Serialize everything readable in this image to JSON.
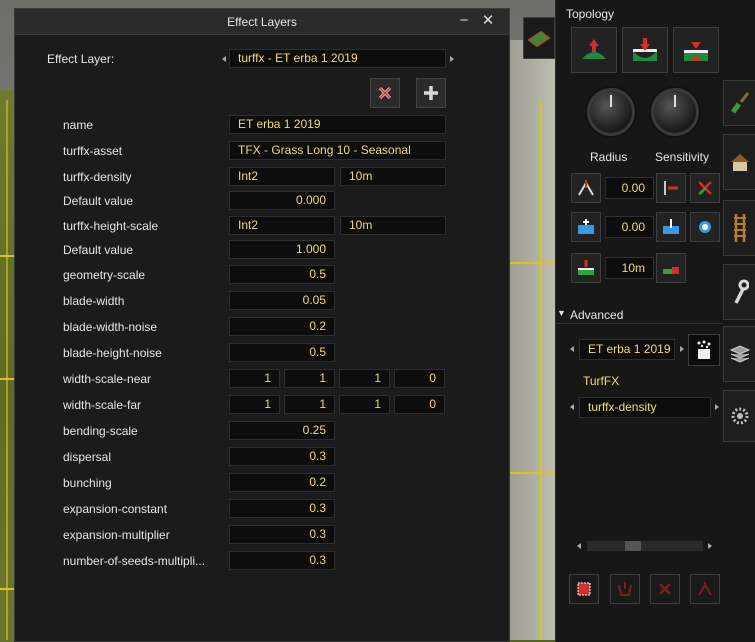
{
  "window": {
    "title": "Effect Layers",
    "minimize_glyph": "−",
    "close_glyph": "✕"
  },
  "effect_layer": {
    "label": "Effect Layer:",
    "value": "turffx - ET erba 1 2019"
  },
  "properties": [
    {
      "label": "name",
      "values": [
        "ET erba 1 2019"
      ]
    },
    {
      "label": "turffx-asset",
      "values": [
        "TFX - Grass Long 10 - Seasonal"
      ]
    },
    {
      "label": "turffx-density",
      "values": [
        "Int2",
        "10m"
      ]
    },
    {
      "label": "Default value",
      "values": [
        "0.000"
      ]
    },
    {
      "label": "turffx-height-scale",
      "values": [
        "Int2",
        "10m"
      ]
    },
    {
      "label": "Default value",
      "values": [
        "1.000"
      ]
    },
    {
      "label": "geometry-scale",
      "values": [
        "0.5"
      ]
    },
    {
      "label": "blade-width",
      "values": [
        "0.05"
      ]
    },
    {
      "label": "blade-width-noise",
      "values": [
        "0.2"
      ]
    },
    {
      "label": "blade-height-noise",
      "values": [
        "0.5"
      ]
    },
    {
      "label": "width-scale-near",
      "values": [
        "1",
        "1",
        "1",
        "0"
      ]
    },
    {
      "label": "width-scale-far",
      "values": [
        "1",
        "1",
        "1",
        "0"
      ]
    },
    {
      "label": "bending-scale",
      "values": [
        "0.25"
      ]
    },
    {
      "label": "dispersal",
      "values": [
        "0.3"
      ]
    },
    {
      "label": "bunching",
      "values": [
        "0.2"
      ]
    },
    {
      "label": "expansion-constant",
      "values": [
        "0.3"
      ]
    },
    {
      "label": "expansion-multiplier",
      "values": [
        "0.3"
      ]
    },
    {
      "label": "number-of-seeds-multipli...",
      "values": [
        "0.3"
      ]
    }
  ],
  "panel": {
    "topology_label": "Topology",
    "radius_label": "Radius",
    "sensitivity_label": "Sensitivity",
    "value_1": "0.00",
    "value_2": "0.00",
    "value_3": "10m",
    "advanced_label": "Advanced",
    "layer_select": "ET erba 1 2019",
    "turffx_label": "TurfFX",
    "param_select": "turffx-density"
  },
  "colors": {
    "value_text": "#f0dc70",
    "accent_red": "#d0302a",
    "accent_green": "#2fa044"
  }
}
